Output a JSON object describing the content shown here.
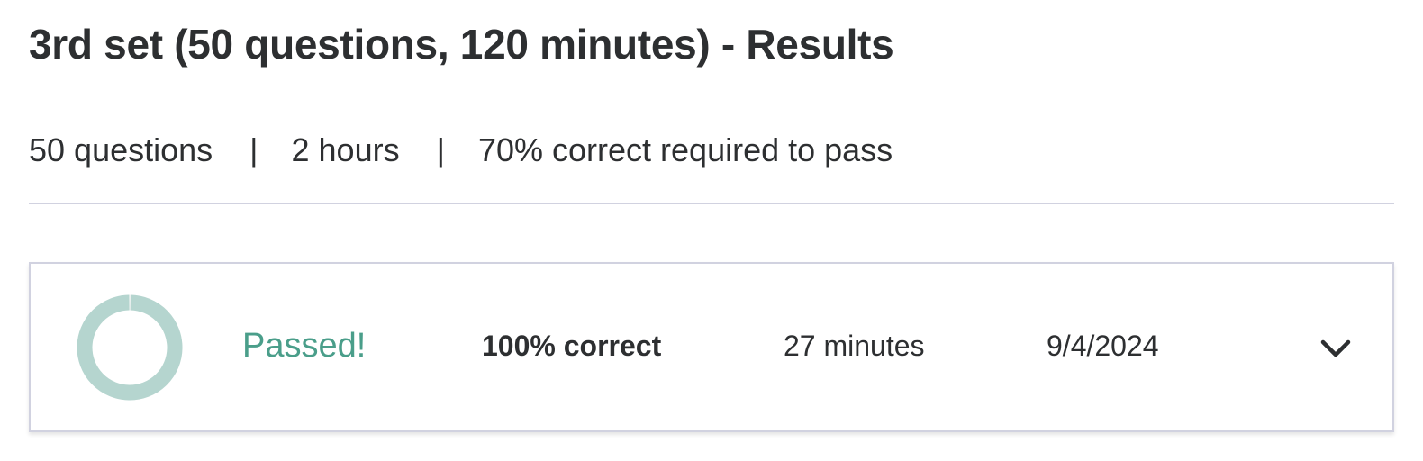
{
  "page": {
    "title": "3rd set (50 questions, 120 minutes) - Results"
  },
  "summary": {
    "questions": "50 questions",
    "separator": "|",
    "duration": "2 hours",
    "pass_requirement": "70% correct required to pass"
  },
  "attempt": {
    "status": "Passed!",
    "score_label": "100% correct",
    "score_fraction": 1.0,
    "time_taken": "27 minutes",
    "date": "9/4/2024",
    "expand_icon": "chevron-down-icon"
  },
  "colors": {
    "text": "#2d2f31",
    "passed": "#4a9e8a",
    "donut": "#b5d5cf",
    "border": "#d1d2e0"
  }
}
